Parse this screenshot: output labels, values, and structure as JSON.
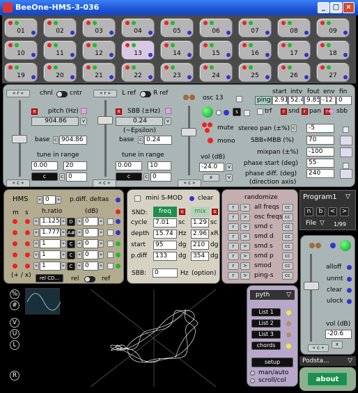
{
  "window": {
    "title": "BeeOne-HMS-3-036"
  },
  "grid": {
    "oscillators": [
      "01",
      "02",
      "03",
      "04",
      "05",
      "06",
      "07",
      "08",
      "09",
      "10",
      "11",
      "12",
      "13",
      "14",
      "15",
      "16",
      "17",
      "18",
      "19",
      "20",
      "21",
      "22",
      "23",
      "24",
      "25",
      "26",
      "27"
    ],
    "selected": "13"
  },
  "osc_panel": {
    "chnl": "chnl",
    "cntr": "cntr",
    "lref": "L ref",
    "rref": "R ref",
    "pitch_label": "pitch (Hz)",
    "pitch_value": "904.86",
    "v": "v",
    "sbb_label": "SBB (±Hz)",
    "sbb_value": "0.24",
    "epsilon": "(~Epsilon)",
    "base": "base",
    "c": "c",
    "base_pitch": "904.86",
    "base_sbb": "0.24",
    "tune": "tune in range",
    "range1_lo": "0.00",
    "range1_hi": "20",
    "range2_lo": "0.00",
    "range2_hi": "10",
    "zero": "0",
    "osc_label": "osc 13",
    "mute": "mute",
    "mono": "mono",
    "s": "s",
    "vol_label": "vol (dB)",
    "vol_value": "-24.0",
    "x": "x",
    "headers": [
      "start",
      "intv",
      "fout",
      "env",
      "fin"
    ],
    "ping": "ping",
    "env_values": [
      "2.91",
      "52.4",
      "9.85",
      "-12",
      "0"
    ],
    "flags": [
      "trf",
      "snd",
      "pan",
      "sbb"
    ],
    "stereo_pan": "stereo pan (±%)",
    "stereo_pan_val": "-5",
    "sbb_mbb": "SBB»MBB (%)",
    "sbb_mbb_val": "70",
    "mixpan": "mixpan (±%)",
    "mixpan_val": "-100",
    "phase_start": "phase start (deg)",
    "phase_start_val": "55",
    "phase_diff": "phase diff. (deg)",
    "phase_diff_val": "240",
    "direction": "(direction axis)",
    "left_btn": "« c »",
    "lr_btn": "« r »"
  },
  "hms": {
    "title": "HMS",
    "m": "m",
    "s": "s",
    "pdiff_val": "0",
    "pdiff": "p.diff. deltas",
    "hratio": "h.ratio",
    "db": "(dB)",
    "rows": [
      {
        "ratio": "1.125",
        "note": "D",
        "db": "0"
      },
      {
        "ratio": "1.777",
        "note": "A#",
        "db": "0"
      },
      {
        "ratio": "1",
        "note": "C",
        "db": "0"
      },
      {
        "ratio": "1",
        "note": "C",
        "db": "0"
      },
      {
        "ratio": "1",
        "note": "C",
        "db": "0"
      }
    ],
    "plusx": "(+ / x)",
    "relcd": "rel CD...",
    "rel": "rel",
    "ref": "ref"
  },
  "mod": {
    "title": "mini S-MOD",
    "clear": "clear",
    "snd": "SND:",
    "freq": "freq",
    "mix": "mix",
    "rows": [
      {
        "label": "cycle",
        "a": "7.01",
        "au": "sc",
        "b": "1.29",
        "bu": "sc"
      },
      {
        "label": "depth",
        "a": "15.74",
        "au": "Hz",
        "b": "2.96",
        "bu": "xR"
      },
      {
        "label": "start",
        "a": "95",
        "au": "dg",
        "b": "210",
        "bu": "dg"
      },
      {
        "label": "p.diff",
        "a": "133",
        "au": "dg",
        "b": "354",
        "bu": "dg"
      }
    ],
    "sbb": "SBB:",
    "sbb_val": "0",
    "hz": "Hz",
    "option": "(option)"
  },
  "randomize": {
    "title": "randomize",
    "items": [
      "all freqs",
      "osc freqs",
      "smd c",
      "smd d",
      "smd s",
      "smd p",
      "smod",
      "ping-s"
    ],
    "cc": "cc"
  },
  "program": {
    "name": "Program1",
    "n": "n",
    "b": "b",
    "prev": "<",
    "next": ">",
    "file": "File",
    "count": "1/99"
  },
  "right": {
    "alloff": "alloff",
    "unmt": "unmt",
    "clear": "clear",
    "ulock": "ulock",
    "vol": "vol (dB)",
    "vol_val": "-20.6",
    "x": "x"
  },
  "bottom": {
    "pyth": "pyth",
    "lists": [
      "List 1",
      "List 2",
      "List 3",
      "chords"
    ],
    "setup": "setup",
    "manauto": "man/auto",
    "scroll": "scroll/col",
    "podsta": "Podsta...",
    "about": "about"
  },
  "side_icons": [
    "%",
    "#",
    "V",
    "U",
    "L",
    "R"
  ],
  "colors": {
    "panel": "#aab5b5",
    "dark": "#4a4a4a",
    "accent": "#1e8e4e",
    "lavender": "#b7a8c9"
  }
}
